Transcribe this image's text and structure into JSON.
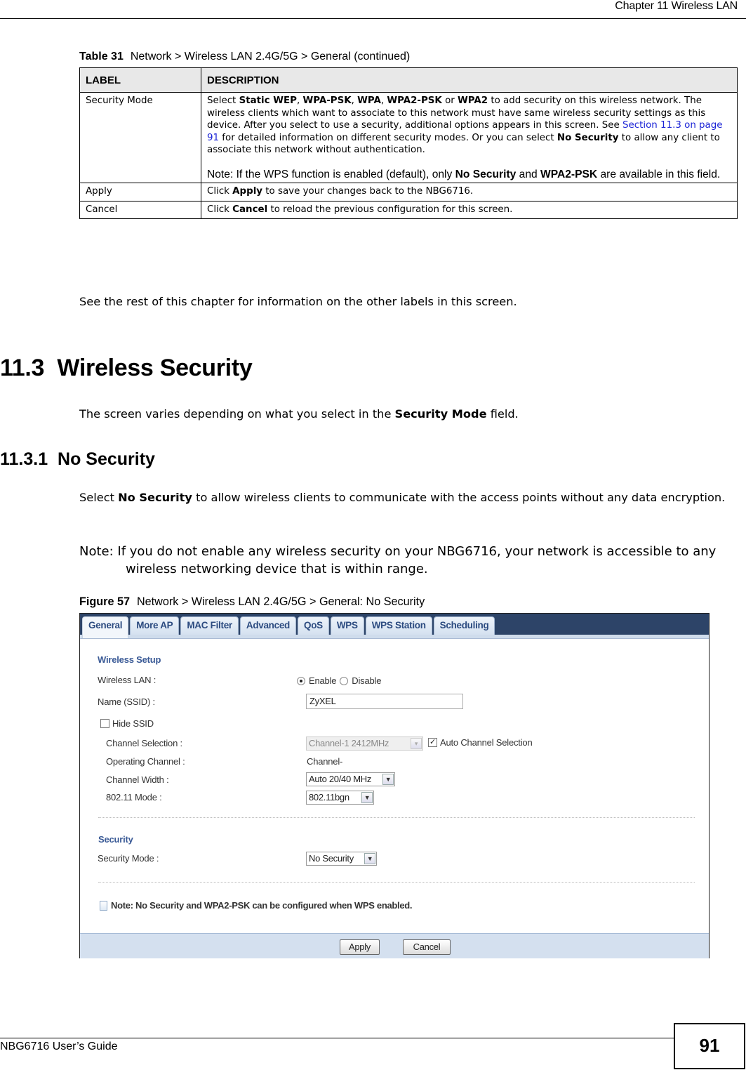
{
  "header": {
    "chapter_title": "Chapter 11 Wireless LAN"
  },
  "table": {
    "caption_number": "Table 31",
    "caption_text": "Network > Wireless LAN 2.4G/5G > General (continued)",
    "headers": [
      "LABEL",
      "DESCRIPTION"
    ],
    "rows": [
      {
        "label": "Security Mode",
        "desc_parts": {
          "p1": "Select ",
          "b1": "Static WEP",
          "p2": ", ",
          "b2": "WPA-PSK",
          "p3": ", ",
          "b3": "WPA",
          "p4": ", ",
          "b4": "WPA2-PSK",
          "p5": " or ",
          "b5": "WPA2",
          "p6": " to add security on this wireless network. The wireless clients which want to associate to this network must have same wireless security settings as this device. After you select to use a security, additional options appears in this screen. See ",
          "link": "Section 11.3 on page 91",
          "p7": " for detailed information on different security modes. Or you can select ",
          "b6": "No Security",
          "p8": " to allow any client to associate this network without authentication."
        },
        "note_parts": {
          "p1": "Note: If the WPS function is enabled (default), only ",
          "b1": "No Security",
          "p2": " and ",
          "b2": "WPA2-PSK",
          "p3": " are available in this field."
        }
      },
      {
        "label": "Apply",
        "desc_parts": {
          "p1": "Click ",
          "b1": "Apply",
          "p2": " to save your changes back to the NBG6716."
        }
      },
      {
        "label": "Cancel",
        "desc_parts": {
          "p1": "Click ",
          "b1": "Cancel",
          "p2": " to reload the previous configuration for this screen."
        }
      }
    ]
  },
  "after_table_text": "See the rest of this chapter for information on the other labels in this screen.",
  "section": {
    "heading": "11.3  Wireless Security",
    "intro_parts": {
      "p1": "The screen varies depending on what you select in the ",
      "b1": "Security Mode",
      "p2": " field."
    }
  },
  "subsection": {
    "heading": "11.3.1  No Security",
    "body_parts": {
      "p1": "Select ",
      "b1": "No Security",
      "p2": " to allow wireless clients to communicate with the access points without any data encryption."
    },
    "note": "Note: If you do not enable any wireless security on your NBG6716, your network is accessible to any wireless networking device that is within range."
  },
  "figure": {
    "caption_number": "Figure 57",
    "caption_text": "Network > Wireless LAN 2.4G/5G > General: No Security",
    "tabs": [
      {
        "label": "General",
        "active": true
      },
      {
        "label": "More AP",
        "active": false
      },
      {
        "label": "MAC Filter",
        "active": false
      },
      {
        "label": "Advanced",
        "active": false
      },
      {
        "label": "QoS",
        "active": false
      },
      {
        "label": "WPS",
        "active": false
      },
      {
        "label": "WPS Station",
        "active": false
      },
      {
        "label": "Scheduling",
        "active": false
      }
    ],
    "wireless_setup": {
      "title": "Wireless Setup",
      "wireless_lan_label": "Wireless LAN :",
      "enable_label": "Enable",
      "disable_label": "Disable",
      "wireless_lan_value": "Enable",
      "ssid_label": "Name (SSID) :",
      "ssid_value": "ZyXEL",
      "hide_ssid_label": "Hide SSID",
      "hide_ssid_checked": false,
      "channel_selection_label": "Channel Selection :",
      "channel_selection_value": "Channel-1 2412MHz",
      "auto_channel_label": "Auto Channel Selection",
      "auto_channel_checked": true,
      "operating_channel_label": "Operating Channel :",
      "operating_channel_value": "Channel-",
      "channel_width_label": "Channel Width :",
      "channel_width_value": "Auto 20/40 MHz",
      "mode_label": "802.11 Mode :",
      "mode_value": "802.11bgn"
    },
    "security": {
      "title": "Security",
      "mode_label": "Security Mode :",
      "mode_value": "No Security"
    },
    "note": "Note: No Security and WPA2-PSK can be configured when WPS enabled.",
    "apply_label": "Apply",
    "cancel_label": "Cancel",
    "colors": {
      "tabbar": "#2d4468",
      "tab_text": "#2c4b80",
      "section_title": "#3a5a96",
      "footer": "#d4e0ef"
    }
  },
  "footer": {
    "guide_title": "NBG6716 User’s Guide",
    "page_number": "91"
  }
}
